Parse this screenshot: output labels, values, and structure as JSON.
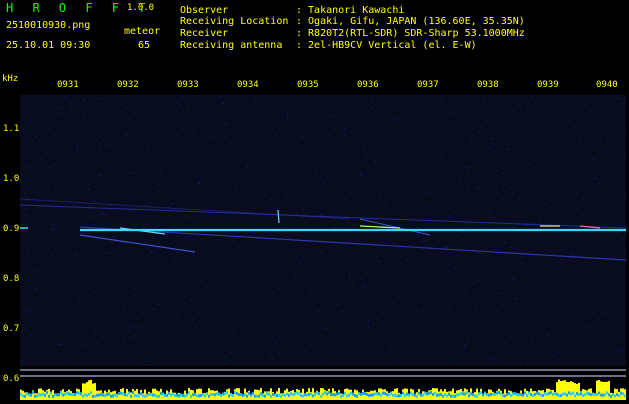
{
  "header": {
    "app_name": "H R O F F T",
    "version": "1.0.0",
    "filename": "2510010930.png",
    "timestamp": "25.10.01 09:30",
    "meteor_label": "meteor",
    "meteor_count": "65",
    "info": [
      {
        "label": "Observer",
        "value": ": Takanori Kawachi"
      },
      {
        "label": "Receiving Location",
        "value": ": Ogaki, Gifu, JAPAN (136.60E, 35.35N)"
      },
      {
        "label": "Receiver",
        "value": ": R820T2(RTL-SDR) SDR-Sharp 53.1000MHz"
      },
      {
        "label": "Receiving antenna",
        "value": ": 2el-HB9CV Vertical (el. E-W)"
      }
    ]
  },
  "spectrogram": {
    "unit_label": "kHz",
    "x_ticks": [
      "0931",
      "0932",
      "0933",
      "0934",
      "0935",
      "0936",
      "0937",
      "0938",
      "0939",
      "0940"
    ],
    "y_ticks": [
      "1.1",
      "1.0",
      "0.9",
      "0.8",
      "0.7",
      "0.6"
    ],
    "carrier_khz": 0.9,
    "colors": {
      "background": "#090b1e",
      "label": "#ffff00",
      "title": "#00ff00",
      "carrier": "#3ad7ff"
    }
  }
}
